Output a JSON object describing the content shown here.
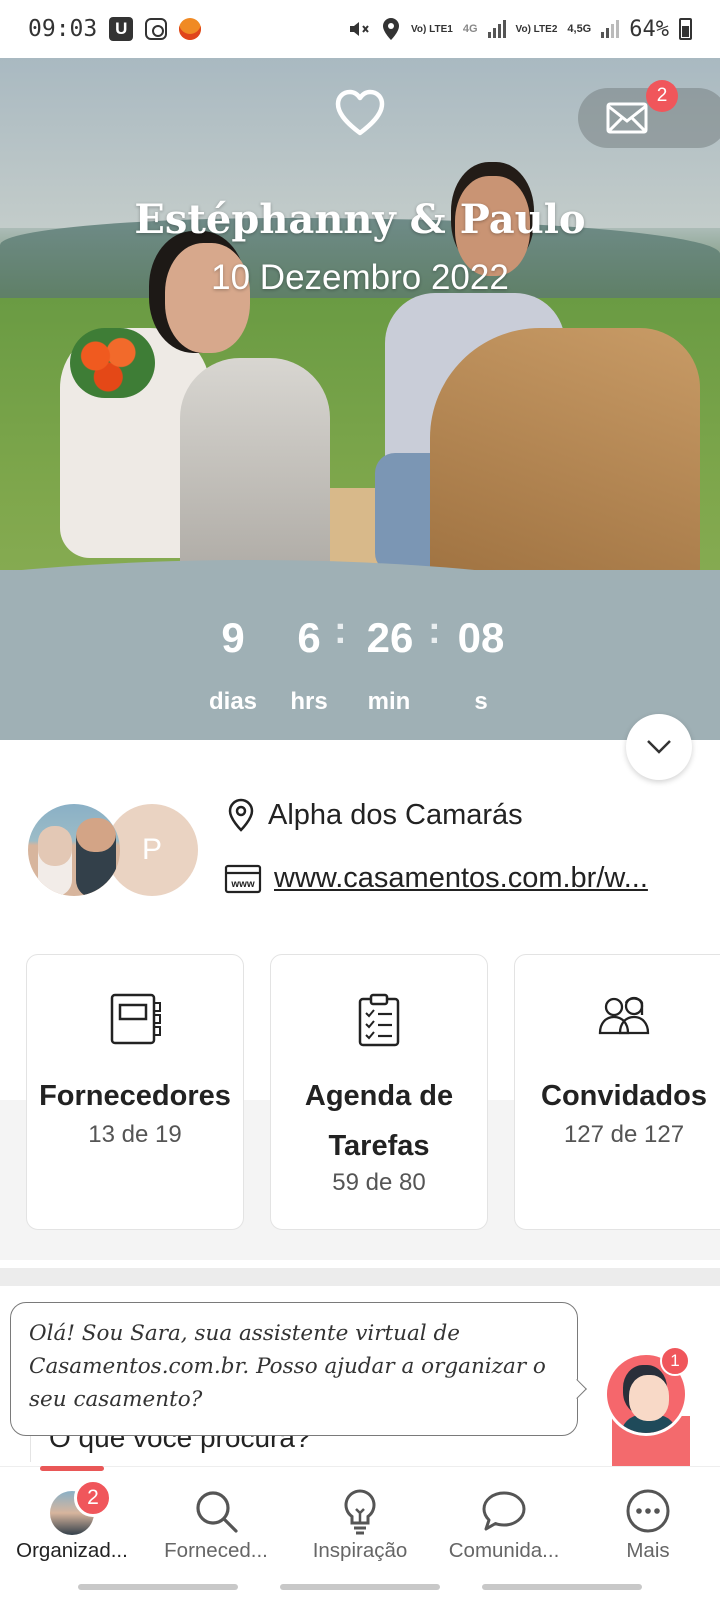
{
  "status_bar": {
    "time": "09:03",
    "notification_badge": "U",
    "network_1": "Vo) LTE1",
    "network_2": "Vo) LTE2",
    "gen_1": "4G",
    "gen_2": "4,5G",
    "battery": "64%"
  },
  "header": {
    "couple_names": "Estéphanny & Paulo",
    "wedding_date": "10 Dezembro 2022",
    "messages_badge": "2"
  },
  "countdown": {
    "days": "9",
    "days_label": "dias",
    "hours": "6",
    "hours_label": "hrs",
    "minutes": "26",
    "minutes_label": "min",
    "seconds": "08",
    "seconds_label": "s",
    "separator": ":"
  },
  "info": {
    "partner_initial": "P",
    "location": "Alpha dos Camarás",
    "website": "www.casamentos.com.br/w...",
    "website_icon_text": "www"
  },
  "cards": [
    {
      "title": "Fornecedores",
      "subtitle": "13 de 19",
      "icon": "notebook-icon"
    },
    {
      "title": "Agenda de Tarefas",
      "subtitle": "59 de 80",
      "icon": "checklist-icon"
    },
    {
      "title": "Convidados",
      "subtitle": "127 de 127",
      "icon": "guests-icon"
    }
  ],
  "assistant": {
    "message": "Olá! Sou Sara, sua assistente virtual de Casamentos.com.br. Posso ajudar a organizar o seu casamento?",
    "badge": "1"
  },
  "search": {
    "placeholder": "O que você procura?"
  },
  "bottom_nav": {
    "items": [
      {
        "label": "Organizad...",
        "icon": "avatar",
        "badge": "2",
        "active": true
      },
      {
        "label": "Forneced...",
        "icon": "search-icon"
      },
      {
        "label": "Inspiração",
        "icon": "lightbulb-icon"
      },
      {
        "label": "Comunida...",
        "icon": "chat-bubble-icon"
      },
      {
        "label": "Mais",
        "icon": "more-icon"
      }
    ]
  },
  "colors": {
    "accent": "#f0565b",
    "countdown_bg": "#9fb0b5",
    "text": "#222222"
  }
}
